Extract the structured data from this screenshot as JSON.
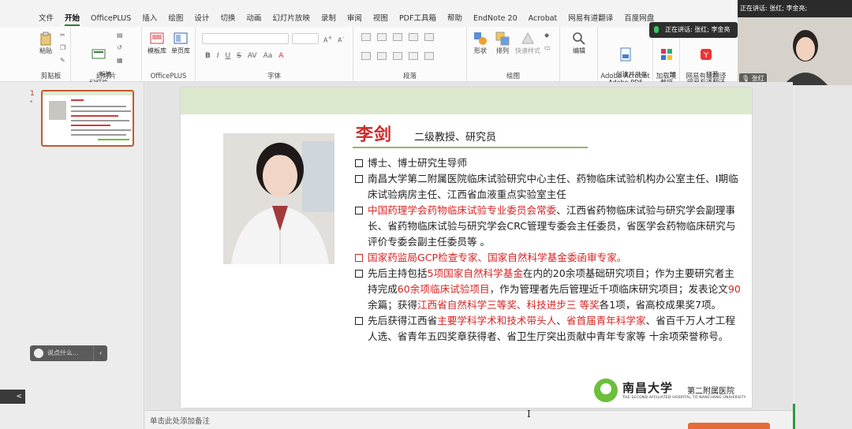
{
  "ribbon_tabs": [
    {
      "label": "文件",
      "active": false
    },
    {
      "label": "开始",
      "active": true
    },
    {
      "label": "OfficePLUS",
      "active": false
    },
    {
      "label": "插入",
      "active": false
    },
    {
      "label": "绘图",
      "active": false
    },
    {
      "label": "设计",
      "active": false
    },
    {
      "label": "切换",
      "active": false
    },
    {
      "label": "动画",
      "active": false
    },
    {
      "label": "幻灯片放映",
      "active": false
    },
    {
      "label": "录制",
      "active": false
    },
    {
      "label": "审阅",
      "active": false
    },
    {
      "label": "视图",
      "active": false
    },
    {
      "label": "PDF工具箱",
      "active": false
    },
    {
      "label": "帮助",
      "active": false
    },
    {
      "label": "EndNote 20",
      "active": false
    },
    {
      "label": "Acrobat",
      "active": false
    },
    {
      "label": "网易有道翻译",
      "active": false
    },
    {
      "label": "百度网盘",
      "active": false
    }
  ],
  "ribbon": {
    "clipboard": {
      "paste": "粘贴",
      "label": "剪贴板"
    },
    "slides": {
      "new_slide": "新建\n幻灯片",
      "label": "幻灯片"
    },
    "officeplus": {
      "templates": "模板库",
      "single_page": "单页库",
      "label": "OfficePLUS"
    },
    "font": {
      "bold": "B",
      "italic": "I",
      "underline": "U",
      "strike": "S",
      "label": "字体"
    },
    "paragraph": {
      "label": "段落"
    },
    "drawing": {
      "shapes": "形状",
      "arrange": "排列",
      "quick_styles": "快速样式",
      "label": "绘图"
    },
    "editing": {
      "edit": "编辑"
    },
    "acrobat": {
      "create_share": "创建并共享\nAdobe PDF",
      "label": "Adobe Acrobat"
    },
    "addins": {
      "load": "加\n载项",
      "label": "加载项"
    },
    "youdao": {
      "open": "打开\n网易有道翻译",
      "label": "网易有道翻译"
    }
  },
  "meeting": {
    "speaking_label": "正在讲话:",
    "speaking_names": "张红; 李金亮;",
    "pill_text": "正在讲话: 张红; 李金亮",
    "name_tag": "张红"
  },
  "thumbnail": {
    "number": "1",
    "star": "*"
  },
  "comment_box": {
    "placeholder": "说点什么..."
  },
  "left_control": {
    "label": "<"
  },
  "slide": {
    "name": "李剑",
    "title": "二级教授、研究员",
    "bullets": {
      "b1": "博士、博士研究生导师",
      "b2": "南昌大学第二附属医院临床试验研究中心主任、药物临床试验机构办公室主任、Ⅰ期临床试验病房主任、江西省血液重点实验室主任",
      "b3_red": "中国药理学会药物临床试验专业委员会常委",
      "b3_rest": "、江西省药物临床试验与研究学会副理事长、省药物临床试验与研究学会CRC管理专委会主任委员，省医学会药物临床研究与评价专委会副主任委员等 。",
      "b4_red": "国家药监局GCP检查专家、国家自然科学基金委函审专家。",
      "b5_a": "先后主持包括",
      "b5_red1": "5项国家自然科学基金",
      "b5_b": "在内的20余项基础研究项目；作为主要研究者主持完成",
      "b5_red2": "60余项临床试验项目",
      "b5_c": "，作为管理者先后管理近千项临床研究项目；发表论文",
      "b5_red3": "90",
      "b5_d": "余篇；获得",
      "b5_red4": "江西省自然科学三等奖、科技进步三 等奖",
      "b5_e": "各1项，省高校成果奖7项。",
      "b6_a": "先后获得江西省",
      "b6_red1": "主要学科学术和技术带头人",
      "b6_b": "、",
      "b6_red2": "省首届青年科学家",
      "b6_c": "、省百千万人才工程人选、省青年五四奖章获得者、省卫生厅突出贡献中青年专家等 十余项荣誉称号。"
    },
    "logo": {
      "cn_univ": "南昌大学",
      "cn_hosp": "第二附属医院",
      "en": "THE SECOND AFFILIATED HOSPITAL TO NANCHANG UNIVERSITY"
    }
  },
  "notes": {
    "placeholder": "单击此处添加备注"
  },
  "colors": {
    "accent_green": "#2e7d32",
    "name_red": "#cc2a2a",
    "highlight_red": "#d82424",
    "band_green": "#dbe8cd"
  }
}
